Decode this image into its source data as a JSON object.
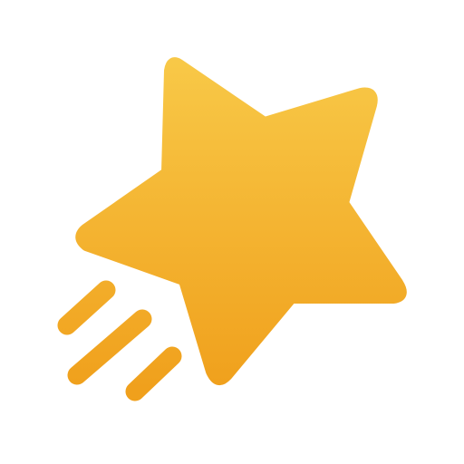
{
  "icon": {
    "name": "shooting-star-icon",
    "colors": {
      "gradient_top": "#F8C948",
      "gradient_bottom": "#F0A01C",
      "background": "#FFFFFF"
    }
  }
}
